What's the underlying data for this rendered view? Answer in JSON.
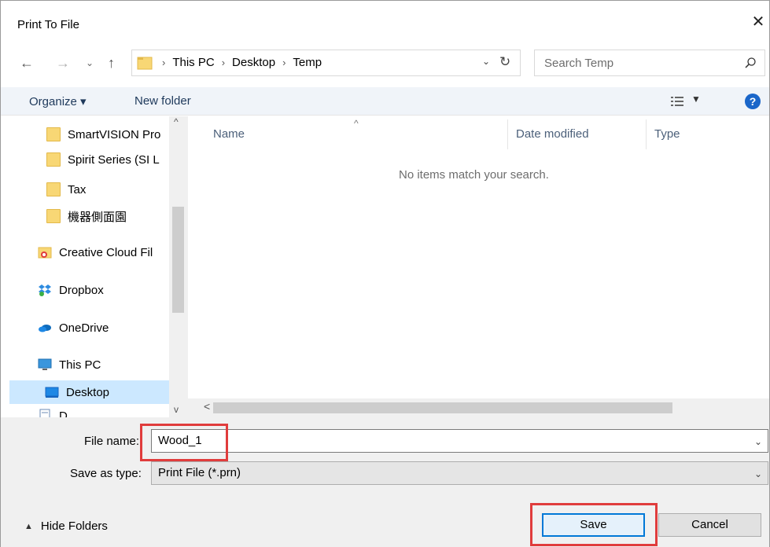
{
  "window": {
    "title": "Print To File",
    "close_glyph": "✕"
  },
  "address": {
    "crumbs": [
      "This PC",
      "Desktop",
      "Temp"
    ],
    "separator": "›"
  },
  "search": {
    "placeholder": "Search Temp"
  },
  "toolbar": {
    "organize": "Organize ▾",
    "new_folder": "New folder",
    "help": "?"
  },
  "nav": {
    "items": [
      {
        "label": "SmartVISION Pro",
        "icon": "folder-icon"
      },
      {
        "label": "Spirit Series (SI L",
        "icon": "folder-icon"
      },
      {
        "label": "Tax",
        "icon": "folder-icon"
      },
      {
        "label": "機器側面園",
        "icon": "folder-icon"
      },
      {
        "label": "Creative Cloud Fil",
        "icon": "creative-cloud-icon"
      },
      {
        "label": "Dropbox",
        "icon": "dropbox-icon"
      },
      {
        "label": "OneDrive",
        "icon": "onedrive-icon"
      },
      {
        "label": "This PC",
        "icon": "this-pc-icon"
      },
      {
        "label": "Desktop",
        "icon": "desktop-icon",
        "selected": true
      },
      {
        "label": "D",
        "icon": "documents-icon"
      }
    ]
  },
  "filelist": {
    "columns": [
      "Name",
      "Date modified",
      "Type"
    ],
    "empty_message": "No items match your search."
  },
  "form": {
    "file_name_label": "File name:",
    "file_name_value": "Wood_1",
    "save_type_label": "Save as type:",
    "save_type_value": "Print File (*.prn)"
  },
  "footer": {
    "hide_folders": "Hide Folders",
    "save": "Save",
    "cancel": "Cancel"
  },
  "colors": {
    "highlight": "#e03c3c",
    "accent": "#0078d7",
    "selection": "#cce8ff"
  }
}
